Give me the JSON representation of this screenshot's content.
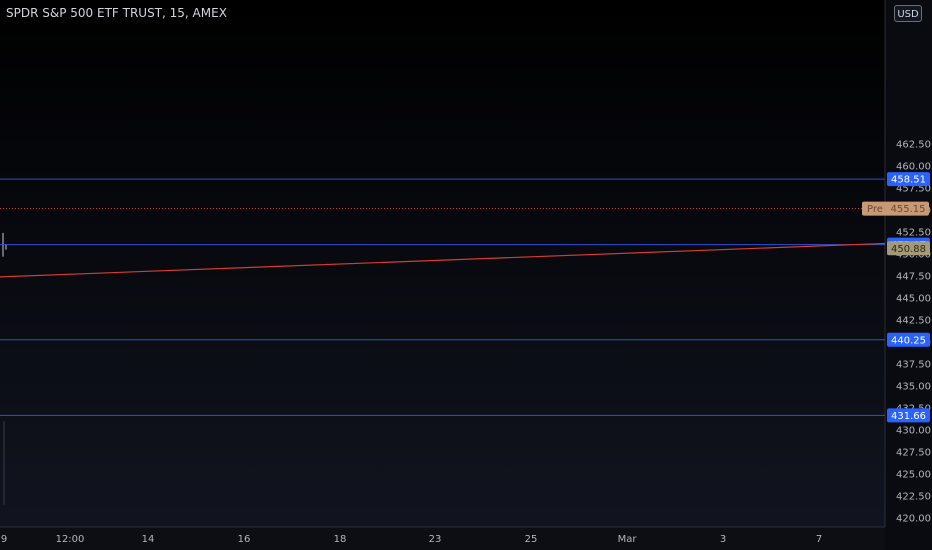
{
  "header": {
    "symbol_title": "SPDR S&P 500 ETF TRUST, 15, AMEX",
    "currency": "USD"
  },
  "colors": {
    "hline": "#2f4fd6",
    "hline_tag": "#2962ff",
    "pre_line": "#e04e38",
    "pre_tag": "#c79a75",
    "close_tag": "#a49a7a",
    "trend": "#d33c32",
    "candle": "#c7c9cf"
  },
  "chart_data": {
    "type": "line",
    "ylim": [
      419.5,
      463.3
    ],
    "y_ticks": [
      420,
      422.5,
      425,
      427.5,
      430,
      432.5,
      435,
      437.5,
      440,
      442.5,
      445,
      447.5,
      450,
      452.5,
      455,
      457.5,
      460,
      462.5
    ],
    "y_tick_labels": [
      "420.00",
      "422.50",
      "425.00",
      "427.50",
      "430.00",
      "432.50",
      "435.00",
      "437.50",
      "440.00",
      "442.50",
      "445.00",
      "447.50",
      "450.00",
      "452.50",
      "455.00",
      "457.50",
      "460.00",
      "462.50"
    ],
    "x_tick_labels": [
      "9",
      "12:00",
      "14",
      "16",
      "18",
      "23",
      "25",
      "Mar",
      "3",
      "7"
    ],
    "horizontal_levels": [
      {
        "value": 458.51,
        "label": "458.51"
      },
      {
        "value": 451.07,
        "label": "451.07"
      },
      {
        "value": 440.25,
        "label": "440.25"
      },
      {
        "value": 431.66,
        "label": "431.66"
      }
    ],
    "pre_market": {
      "value": 455.15,
      "label": "Pre",
      "value_label": "455.15"
    },
    "last_close": {
      "value": 450.88,
      "label": "450.88"
    },
    "trend_line": {
      "start": 447.4,
      "end": 451.2
    }
  }
}
